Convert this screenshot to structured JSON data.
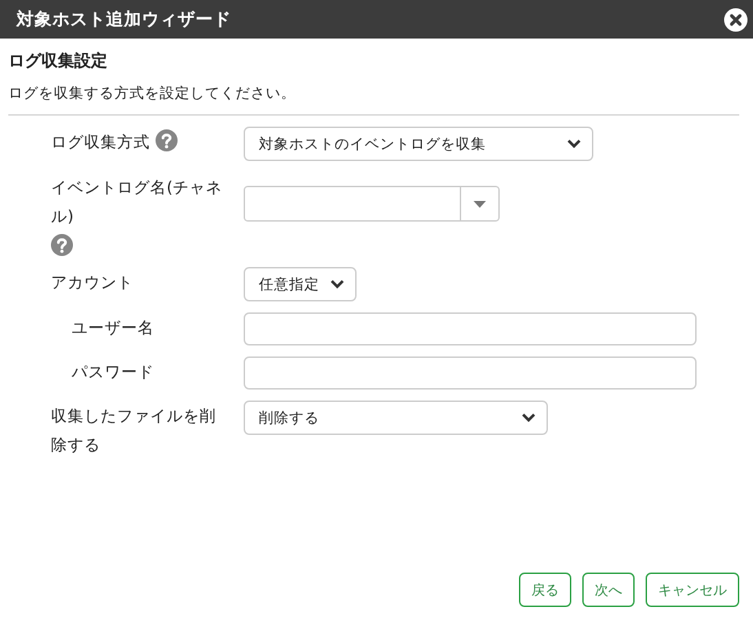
{
  "window": {
    "title": "対象ホスト追加ウィザード"
  },
  "heading": "ログ収集設定",
  "description": "ログを収集する方式を設定してください。",
  "fields": [
    {
      "kind": "select",
      "label": "ログ収集方式",
      "help": true,
      "value": "対象ホストのイベントログを収集"
    },
    {
      "kind": "combo",
      "label": "イベントログ名(チャネル)",
      "help": true
    },
    {
      "kind": "select",
      "label": "アカウント",
      "value": "任意指定"
    },
    {
      "kind": "text",
      "label": "ユーザー名",
      "indented": true
    },
    {
      "kind": "text",
      "label": "パスワード",
      "indented": true
    },
    {
      "kind": "select",
      "label": "収集したファイルを削除する",
      "value": "削除する"
    }
  ],
  "buttons": [
    "戻る",
    "次へ",
    "キャンセル"
  ]
}
